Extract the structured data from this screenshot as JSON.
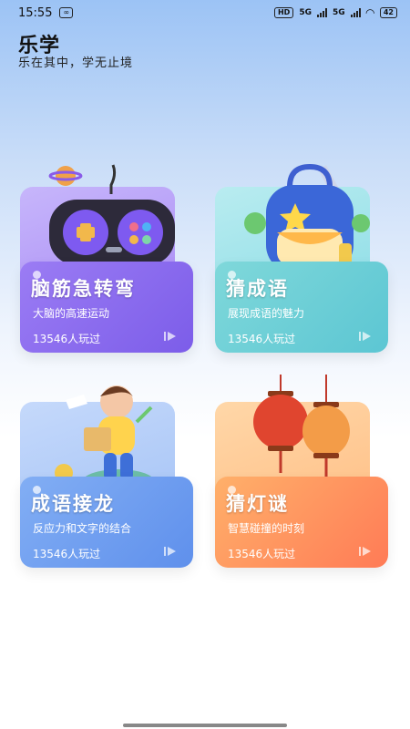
{
  "status": {
    "time": "15:55",
    "battery": "42",
    "net1": "HD",
    "sig1": "5G",
    "sig2": "5G"
  },
  "header": {
    "title": "乐学",
    "subtitle": "乐在其中，学无止境"
  },
  "cards": [
    {
      "title": "脑筋急转弯",
      "desc": "大脑的高速运动",
      "plays": "13546人玩过"
    },
    {
      "title": "猜成语",
      "desc": "展现成语的魅力",
      "plays": "13546人玩过"
    },
    {
      "title": "成语接龙",
      "desc": "反应力和文字的结合",
      "plays": "13546人玩过"
    },
    {
      "title": "猜灯谜",
      "desc": "智慧碰撞的时刻",
      "plays": "13546人玩过"
    }
  ]
}
